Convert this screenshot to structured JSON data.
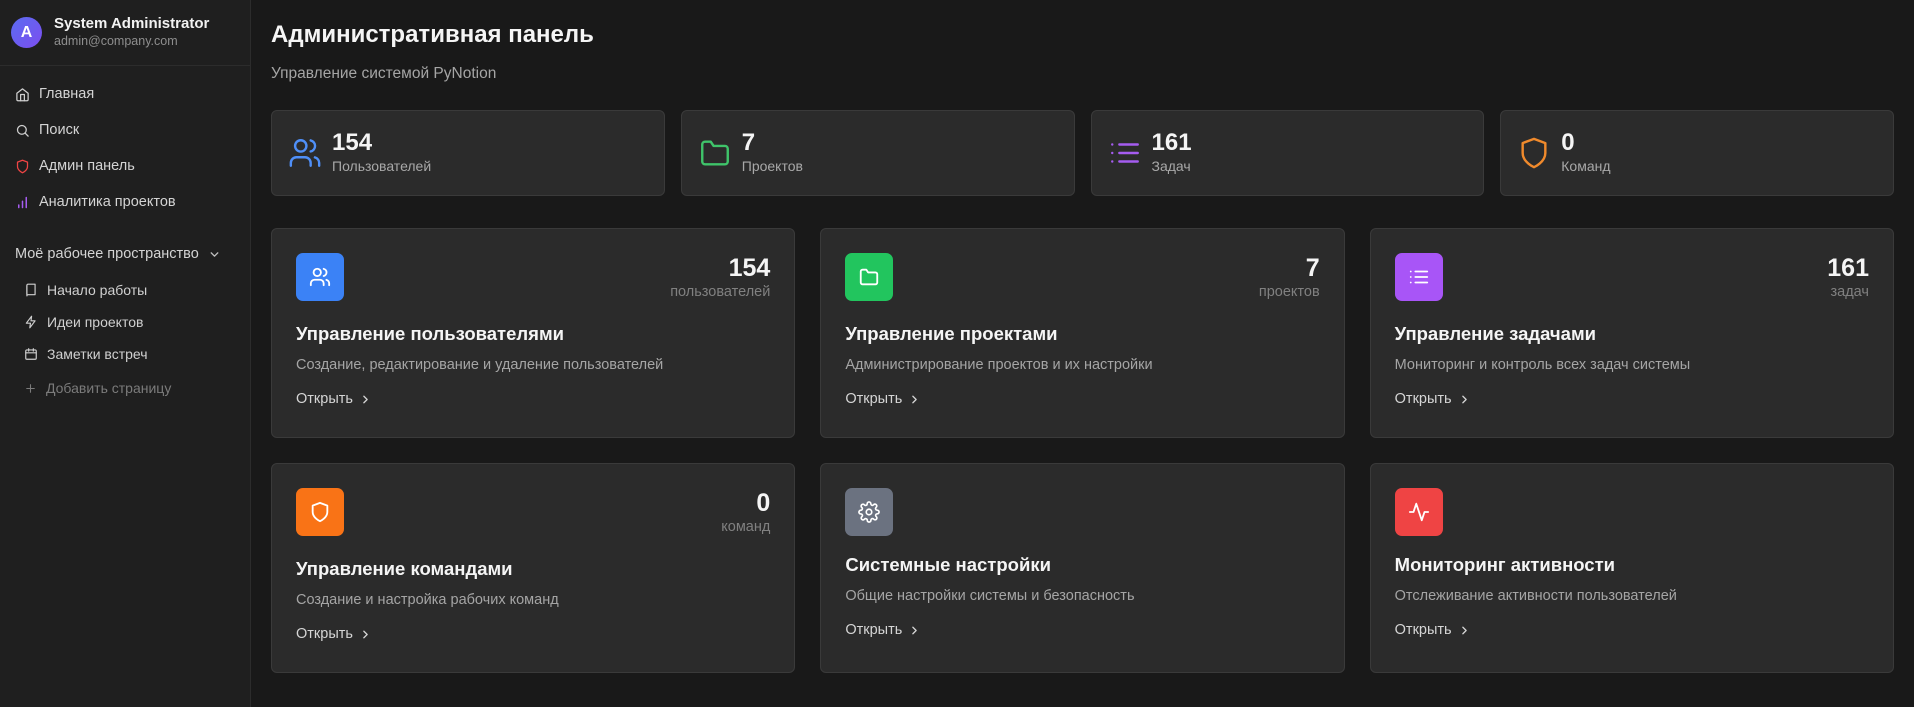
{
  "user": {
    "initial": "A",
    "name": "System Administrator",
    "email": "admin@company.com"
  },
  "nav": [
    {
      "label": "Главная",
      "icon": "home-icon"
    },
    {
      "label": "Поиск",
      "icon": "search-icon"
    },
    {
      "label": "Админ панель",
      "icon": "shield-icon"
    },
    {
      "label": "Аналитика проектов",
      "icon": "bar-chart-icon"
    }
  ],
  "workspace": {
    "title": "Моё рабочее пространство",
    "items": [
      {
        "label": "Начало работы",
        "icon": "book-icon"
      },
      {
        "label": "Идеи проектов",
        "icon": "lightning-icon"
      },
      {
        "label": "Заметки встреч",
        "icon": "calendar-icon"
      }
    ],
    "add_label": "Добавить страницу"
  },
  "header": {
    "title": "Административная панель",
    "subtitle": "Управление системой PyNotion"
  },
  "stats": [
    {
      "value": "154",
      "label": "Пользователей",
      "icon": "users-icon",
      "color": "#4f8ff7"
    },
    {
      "value": "7",
      "label": "Проектов",
      "icon": "folder-icon",
      "color": "#3fc46a"
    },
    {
      "value": "161",
      "label": "Задач",
      "icon": "list-icon",
      "color": "#a55cf0"
    },
    {
      "value": "0",
      "label": "Команд",
      "icon": "shield-icon",
      "color": "#f08a2c"
    }
  ],
  "cards": [
    {
      "count": "154",
      "count_label": "пользователей",
      "title": "Управление пользователями",
      "desc": "Создание, редактирование и удаление пользователей",
      "open": "Открыть",
      "icon": "users-icon",
      "color": "#3b82f6"
    },
    {
      "count": "7",
      "count_label": "проектов",
      "title": "Управление проектами",
      "desc": "Администрирование проектов и их настройки",
      "open": "Открыть",
      "icon": "folder-icon",
      "color": "#22c55e"
    },
    {
      "count": "161",
      "count_label": "задач",
      "title": "Управление задачами",
      "desc": "Мониторинг и контроль всех задач системы",
      "open": "Открыть",
      "icon": "list-icon",
      "color": "#a855f7"
    },
    {
      "count": "0",
      "count_label": "команд",
      "title": "Управление командами",
      "desc": "Создание и настройка рабочих команд",
      "open": "Открыть",
      "icon": "shield-icon",
      "color": "#f97316"
    },
    {
      "title": "Системные настройки",
      "desc": "Общие настройки системы и безопасность",
      "open": "Открыть",
      "icon": "gear-icon",
      "color": "#6b7280"
    },
    {
      "title": "Мониторинг активности",
      "desc": "Отслеживание активности пользователей",
      "open": "Открыть",
      "icon": "activity-icon",
      "color": "#ef4444"
    }
  ]
}
